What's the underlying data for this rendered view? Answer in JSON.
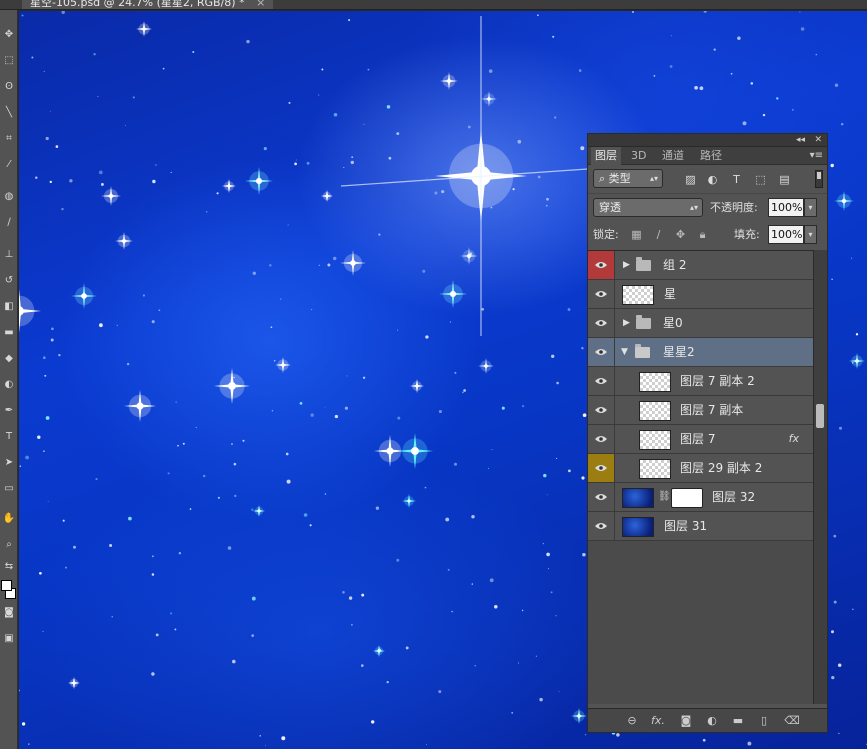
{
  "document": {
    "tab_title": "星空-105.psd @ 24.7% (星星2, RGB/8) *",
    "close_glyph": "×"
  },
  "panel": {
    "collapse_glyph": "◂◂",
    "close_glyph": "✕",
    "tabs": [
      {
        "label": "图层",
        "active": true
      },
      {
        "label": "3D",
        "active": false
      },
      {
        "label": "通道",
        "active": false
      },
      {
        "label": "路径",
        "active": false
      }
    ],
    "menu_glyph": "▾≡",
    "filter": {
      "label": "类型",
      "icon": "search-icon"
    },
    "blend_mode": "穿透",
    "opacity_label": "不透明度:",
    "opacity_value": "100%",
    "lock_label": "锁定:",
    "fill_label": "填充:",
    "fill_value": "100%",
    "layers": [
      {
        "name": "组 2",
        "type": "group",
        "expanded": false,
        "indent": 0,
        "eye_color": "#b33a3a",
        "selected": false
      },
      {
        "name": "星",
        "type": "layer",
        "indent": 0,
        "selected": false
      },
      {
        "name": "星0",
        "type": "group",
        "expanded": false,
        "indent": 0,
        "selected": false
      },
      {
        "name": "星星2",
        "type": "group",
        "expanded": true,
        "indent": 0,
        "selected": true
      },
      {
        "name": "图层 7 副本 2",
        "type": "layer",
        "indent": 1,
        "selected": false
      },
      {
        "name": "图层 7 副本",
        "type": "layer",
        "indent": 1,
        "selected": false
      },
      {
        "name": "图层 7",
        "type": "layer",
        "indent": 1,
        "fx": "fx",
        "selected": false
      },
      {
        "name": "图层 29 副本 2",
        "type": "layer",
        "indent": 1,
        "eye_color": "#9c7d12",
        "selected": false
      },
      {
        "name": "图层 32",
        "type": "masked",
        "indent": 0,
        "selected": false
      },
      {
        "name": "图层 31",
        "type": "space",
        "indent": 0,
        "selected": false
      }
    ],
    "footer_icons": [
      "link-icon",
      "fx-icon",
      "mask-icon",
      "adjustment-icon",
      "new-group-icon",
      "new-layer-icon",
      "trash-icon"
    ]
  },
  "colors": {
    "selected_layer": "#5f6f86",
    "panel_bg": "#535353",
    "canvas_blue": "#0b3ad0"
  }
}
